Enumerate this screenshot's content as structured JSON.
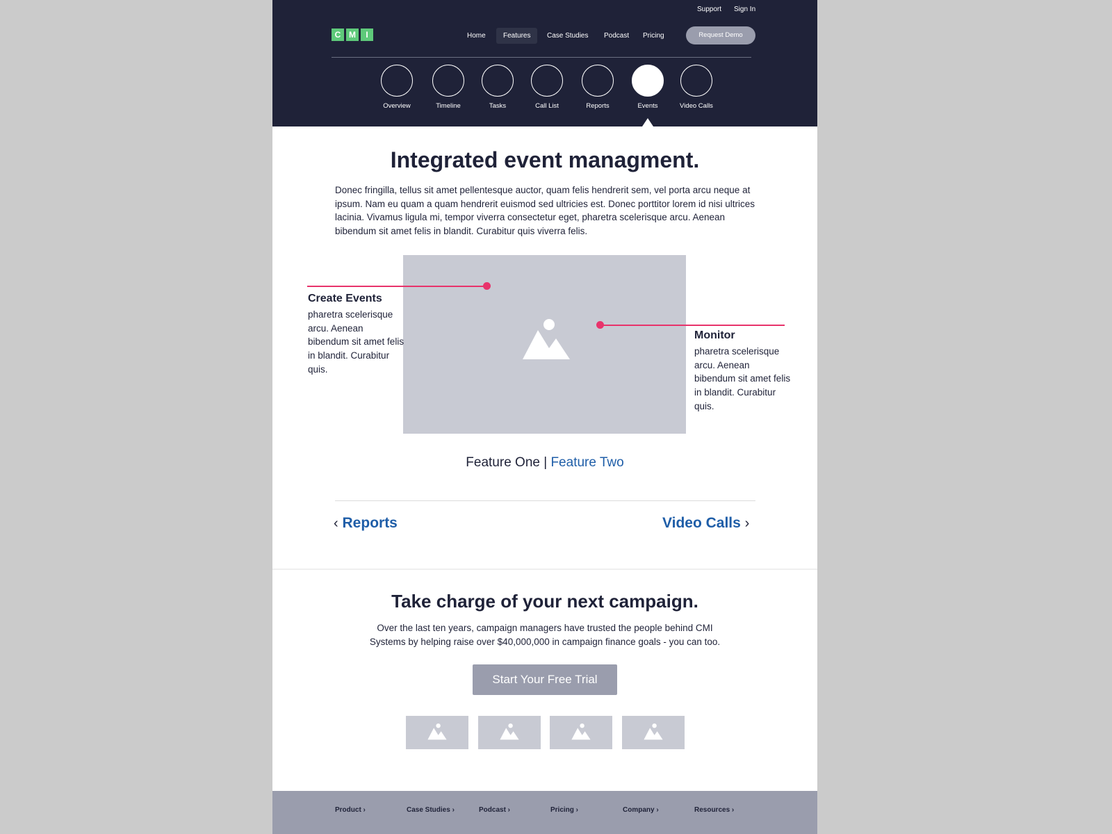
{
  "header": {
    "utility_links": [
      "Support",
      "Sign In"
    ],
    "logo_letters": [
      "C",
      "M",
      "I"
    ],
    "nav": [
      {
        "label": "Home",
        "active": false
      },
      {
        "label": "Features",
        "active": true
      },
      {
        "label": "Case Studies",
        "active": false
      },
      {
        "label": "Podcast",
        "active": false
      },
      {
        "label": "Pricing",
        "active": false
      }
    ],
    "cta_label": "Request Demo",
    "feature_tabs": [
      {
        "label": "Overview",
        "active": false
      },
      {
        "label": "Timeline",
        "active": false
      },
      {
        "label": "Tasks",
        "active": false
      },
      {
        "label": "Call List",
        "active": false
      },
      {
        "label": "Reports",
        "active": false
      },
      {
        "label": "Events",
        "active": true
      },
      {
        "label": "Video Calls",
        "active": false
      }
    ]
  },
  "main": {
    "title": "Integrated event managment.",
    "intro": "Donec fringilla, tellus sit amet pellentesque auctor, quam felis hendrerit sem, vel porta arcu neque at ipsum. Nam eu quam a quam hendrerit euismod sed ultricies est. Donec porttitor lorem id nisi ultrices lacinia. Vivamus ligula mi, tempor viverra consectetur eget, pharetra scelerisque arcu. Aenean bibendum sit amet felis in blandit. Curabitur quis viverra felis.",
    "callouts": [
      {
        "title": "Create Events",
        "text": "pharetra scelerisque arcu. Aenean bibendum sit amet felis in blandit. Curabitur quis."
      },
      {
        "title": "Monitor",
        "text": "pharetra scelerisque arcu. Aenean bibendum sit amet felis in blandit. Curabitur quis."
      }
    ],
    "feature_toggle": {
      "current": "Feature One",
      "separator": " | ",
      "other": "Feature Two"
    },
    "pager": {
      "prev": "Reports",
      "next": "Video Calls",
      "prev_chevron": "‹",
      "next_chevron": "›"
    }
  },
  "cta": {
    "title": "Take charge of your next campaign.",
    "text_line1": "Over the last ten years, campaign managers have trusted the people behind CMI",
    "text_line2": "Systems by helping raise over $40,000,000 in campaign finance goals - you can too.",
    "button": "Start Your Free Trial"
  },
  "footer": {
    "links": [
      "Product ›",
      "Case Studies ›",
      "Podcast ›",
      "Pricing ›",
      "Company ›",
      "Resources ›"
    ]
  },
  "colors": {
    "header_bg": "#1f2238",
    "accent_green": "#5ec97a",
    "callout_pink": "#e8336b",
    "link_blue": "#1f5ea8",
    "muted_button": "#9a9dad",
    "placeholder_gray": "#c8cad3"
  }
}
